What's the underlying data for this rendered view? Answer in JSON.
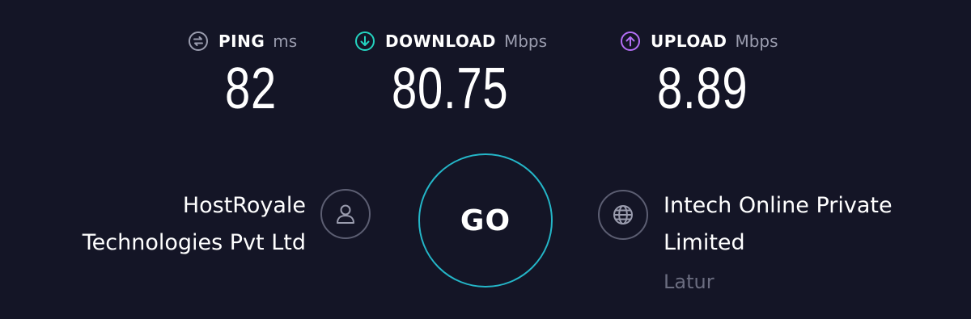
{
  "metrics": {
    "ping": {
      "label": "PING",
      "unit": "ms",
      "value": "82",
      "icon": "ping-icon",
      "color": "#9a9cae"
    },
    "download": {
      "label": "DOWNLOAD",
      "unit": "Mbps",
      "value": "80.75",
      "icon": "download-arrow-icon",
      "color": "#24d3c0"
    },
    "upload": {
      "label": "UPLOAD",
      "unit": "Mbps",
      "value": "8.89",
      "icon": "upload-arrow-icon",
      "color": "#b36ef5"
    }
  },
  "host": {
    "name_line1": "HostRoyale",
    "name_line2": "Technologies Pvt Ltd",
    "icon": "user-icon"
  },
  "server": {
    "name_line1": "Intech Online Private",
    "name_line2": "Limited",
    "location": "Latur",
    "icon": "globe-icon"
  },
  "go_button": {
    "label": "GO",
    "ring_color": "#24b6c8"
  },
  "colors": {
    "background": "#141526",
    "muted": "#9a9cae",
    "dim": "#6b6d80"
  }
}
